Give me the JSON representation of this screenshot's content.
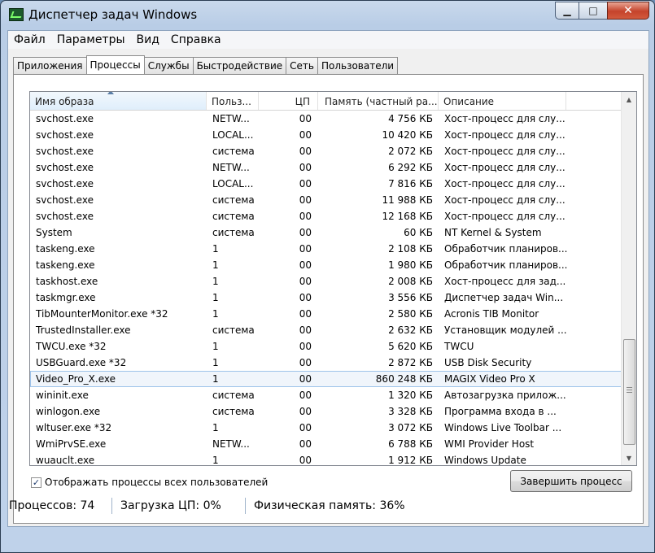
{
  "window": {
    "title": "Диспетчер задач Windows"
  },
  "window_buttons": {
    "minimize": "▁",
    "maximize": "□",
    "close": "✕"
  },
  "menu": [
    "Файл",
    "Параметры",
    "Вид",
    "Справка"
  ],
  "tabs": [
    "Приложения",
    "Процессы",
    "Службы",
    "Быстродействие",
    "Сеть",
    "Пользователи"
  ],
  "active_tab": "Процессы",
  "columns": [
    "Имя образа",
    "Польз...",
    "ЦП",
    "Память (частный ра...",
    "Описание"
  ],
  "sorted_column": "Имя образа",
  "processes": [
    {
      "name": "svchost.exe",
      "user": "NETW...",
      "cpu": "00",
      "mem": "4 756 КБ",
      "desc": "Хост-процесс для слу..."
    },
    {
      "name": "svchost.exe",
      "user": "LOCAL...",
      "cpu": "00",
      "mem": "10 420 КБ",
      "desc": "Хост-процесс для слу..."
    },
    {
      "name": "svchost.exe",
      "user": "система",
      "cpu": "00",
      "mem": "2 072 КБ",
      "desc": "Хост-процесс для слу..."
    },
    {
      "name": "svchost.exe",
      "user": "NETW...",
      "cpu": "00",
      "mem": "6 292 КБ",
      "desc": "Хост-процесс для слу..."
    },
    {
      "name": "svchost.exe",
      "user": "LOCAL...",
      "cpu": "00",
      "mem": "7 816 КБ",
      "desc": "Хост-процесс для слу..."
    },
    {
      "name": "svchost.exe",
      "user": "система",
      "cpu": "00",
      "mem": "11 988 КБ",
      "desc": "Хост-процесс для слу..."
    },
    {
      "name": "svchost.exe",
      "user": "система",
      "cpu": "00",
      "mem": "12 168 КБ",
      "desc": "Хост-процесс для слу..."
    },
    {
      "name": "System",
      "user": "система",
      "cpu": "00",
      "mem": "60 КБ",
      "desc": "NT Kernel & System"
    },
    {
      "name": "taskeng.exe",
      "user": "1",
      "cpu": "00",
      "mem": "2 108 КБ",
      "desc": "Обработчик планиров..."
    },
    {
      "name": "taskeng.exe",
      "user": "1",
      "cpu": "00",
      "mem": "1 980 КБ",
      "desc": "Обработчик планиров..."
    },
    {
      "name": "taskhost.exe",
      "user": "1",
      "cpu": "00",
      "mem": "2 008 КБ",
      "desc": "Хост-процесс для зад..."
    },
    {
      "name": "taskmgr.exe",
      "user": "1",
      "cpu": "00",
      "mem": "3 556 КБ",
      "desc": "Диспетчер задач Win..."
    },
    {
      "name": "TibMounterMonitor.exe *32",
      "user": "1",
      "cpu": "00",
      "mem": "2 580 КБ",
      "desc": "Acronis TIB Monitor"
    },
    {
      "name": "TrustedInstaller.exe",
      "user": "система",
      "cpu": "00",
      "mem": "2 632 КБ",
      "desc": "Установщик модулей ..."
    },
    {
      "name": "TWCU.exe *32",
      "user": "1",
      "cpu": "00",
      "mem": "5 620 КБ",
      "desc": "TWCU"
    },
    {
      "name": "USBGuard.exe *32",
      "user": "1",
      "cpu": "00",
      "mem": "2 872 КБ",
      "desc": "USB Disk Security"
    },
    {
      "name": "Video_Pro_X.exe",
      "user": "1",
      "cpu": "00",
      "mem": "860 248 КБ",
      "desc": "MAGIX Video Pro X",
      "selected": true
    },
    {
      "name": "wininit.exe",
      "user": "система",
      "cpu": "00",
      "mem": "1 320 КБ",
      "desc": "Автозагрузка прилож..."
    },
    {
      "name": "winlogon.exe",
      "user": "система",
      "cpu": "00",
      "mem": "3 328 КБ",
      "desc": "Программа входа в ..."
    },
    {
      "name": "wltuser.exe *32",
      "user": "1",
      "cpu": "00",
      "mem": "3 072 КБ",
      "desc": "Windows Live Toolbar ..."
    },
    {
      "name": "WmiPrvSE.exe",
      "user": "NETW...",
      "cpu": "00",
      "mem": "6 788 КБ",
      "desc": "WMI Provider Host"
    },
    {
      "name": "wuauclt.exe",
      "user": "1",
      "cpu": "00",
      "mem": "1 912 КБ",
      "desc": "Windows Update"
    }
  ],
  "show_all_users": {
    "label": "Отображать процессы всех пользователей",
    "checked": true,
    "mark": "✓"
  },
  "end_process_button": "Завершить процесс",
  "status": {
    "processes": "Процессов: 74",
    "cpu": "Загрузка ЦП: 0%",
    "memory": "Физическая память: 36%"
  }
}
